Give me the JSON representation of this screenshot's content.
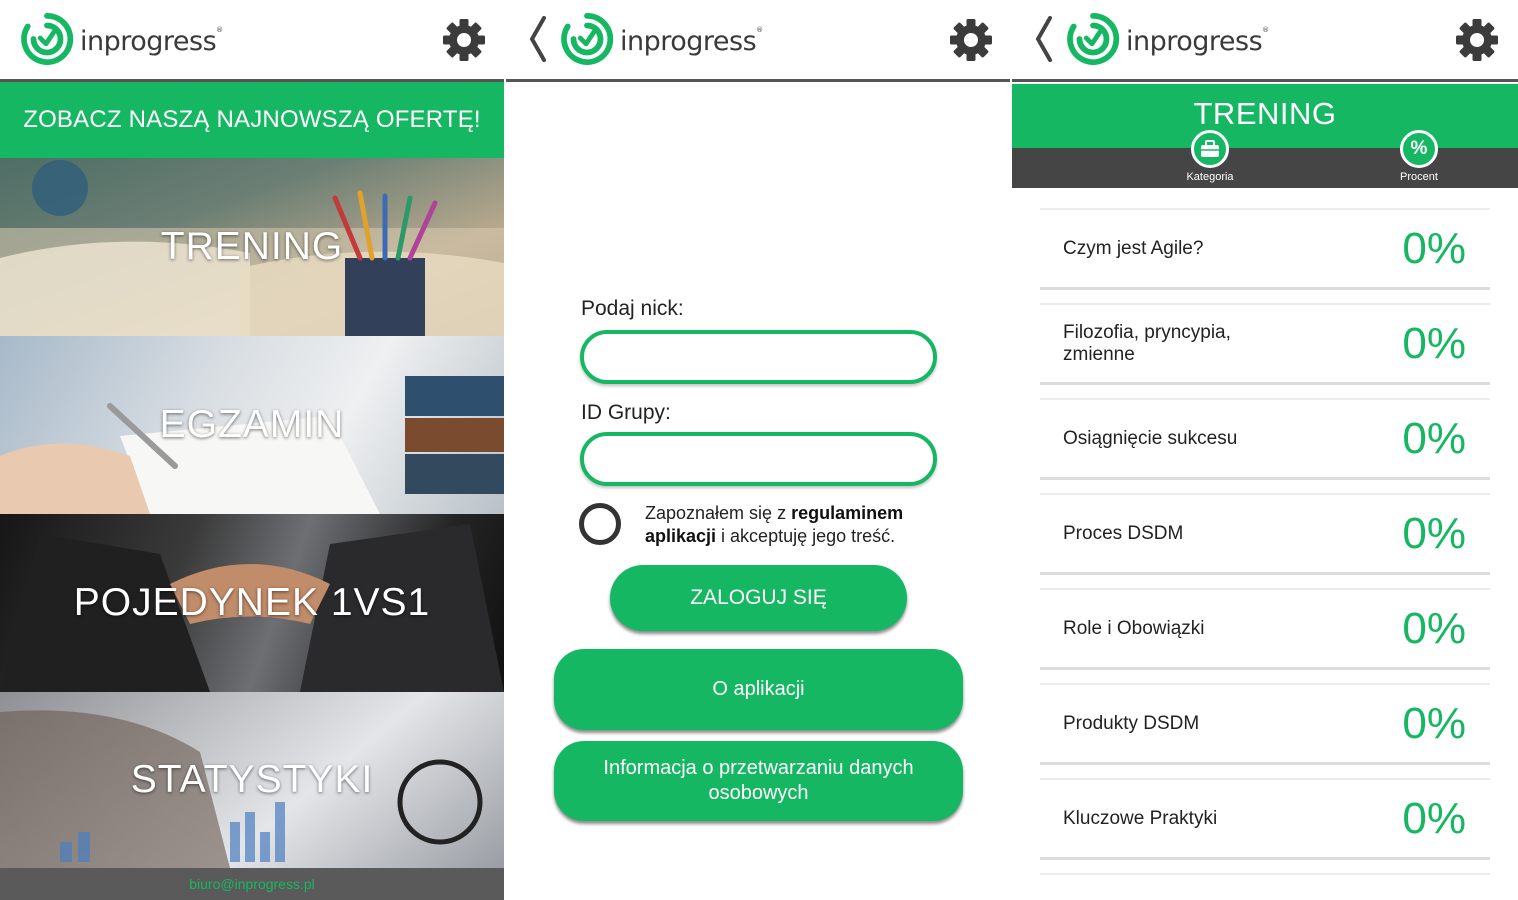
{
  "brand": {
    "name": "inprogress",
    "trademark": "®",
    "accent_color": "#16b763",
    "dark_color": "#454545"
  },
  "screen_home": {
    "banner": "ZOBACZ NASZĄ NAJNOWSZĄ OFERTĘ!",
    "tiles": [
      {
        "label": "TRENING"
      },
      {
        "label": "EGZAMIN"
      },
      {
        "label": "POJEDYNEK 1VS1"
      },
      {
        "label": "STATYSTYKI"
      }
    ],
    "footer_email": "biuro@inprogress.pl"
  },
  "screen_login": {
    "nick_label": "Podaj nick:",
    "nick_value": "",
    "group_label": "ID Grupy:",
    "group_value": "",
    "terms_prefix": "Zapoznałem się z ",
    "terms_bold": "regulaminem aplikacji",
    "terms_suffix": " i akceptuję jego treść.",
    "login_button": "ZALOGUJ SIĘ",
    "about_button": "O aplikacji",
    "privacy_button": "Informacja o przetwarzaniu danych osobowych"
  },
  "screen_training": {
    "title": "TRENING",
    "sort_options": [
      {
        "label": "Kategoria",
        "icon": "briefcase-icon"
      },
      {
        "label": "Procent",
        "icon": "percent-icon",
        "glyph": "%"
      }
    ],
    "categories": [
      {
        "label": "Czym jest Agile?",
        "percent": "0%"
      },
      {
        "label": "Filozofia, pryncypia, zmienne",
        "percent": "0%"
      },
      {
        "label": "Osiągnięcie sukcesu",
        "percent": "0%"
      },
      {
        "label": "Proces DSDM",
        "percent": "0%"
      },
      {
        "label": "Role i Obowiązki",
        "percent": "0%"
      },
      {
        "label": "Produkty DSDM",
        "percent": "0%"
      },
      {
        "label": "Kluczowe Praktyki",
        "percent": "0%"
      }
    ]
  }
}
